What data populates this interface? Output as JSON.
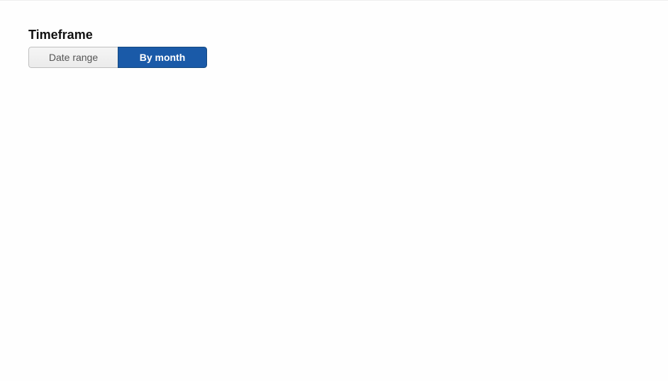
{
  "timeframe": {
    "title": "Timeframe",
    "options": {
      "date_range": "Date range",
      "by_month": "By month"
    }
  }
}
